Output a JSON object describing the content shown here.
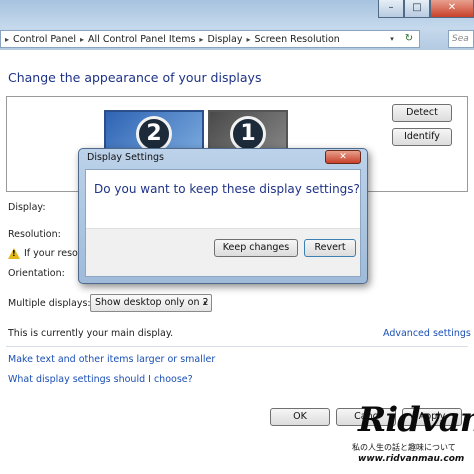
{
  "window": {
    "minimize_glyph": "–",
    "maximize_glyph": "□",
    "close_glyph": "✕"
  },
  "address_bar": {
    "breadcrumbs": [
      "Control Panel",
      "All Control Panel Items",
      "Display",
      "Screen Resolution"
    ],
    "separator": "▸",
    "leading_separator": "▸",
    "dropdown_glyph": "▾",
    "refresh_glyph": "↻",
    "search_placeholder": "Sea"
  },
  "page": {
    "heading": "Change the appearance of your displays",
    "monitors": [
      {
        "number": "2",
        "selected": true
      },
      {
        "number": "1",
        "selected": false
      }
    ],
    "detect_label": "Detect",
    "identify_label": "Identify",
    "display_label": "Display:",
    "resolution_label": "Resolution:",
    "warning_text": "If your resolu",
    "orientation_label": "Orientation:",
    "multiple_displays_label": "Multiple displays:",
    "multiple_displays_value": "Show desktop only on 2",
    "main_display_text": "This is currently your main display.",
    "advanced_settings_link": "Advanced settings",
    "link_text_size": "Make text and other items larger or smaller",
    "link_what_settings": "What display settings should I choose?",
    "ok_label": "OK",
    "cancel_label": "Canc",
    "apply_label": "Apply"
  },
  "dialog": {
    "title": "Display Settings",
    "close_glyph": "✕",
    "question": "Do you want to keep these display settings?",
    "keep_label": "Keep changes",
    "revert_label": "Revert"
  },
  "watermark": {
    "logo": "Ridvan",
    "subtitle": "私の人生の話と趣味について",
    "url": "www.ridvanmau.com"
  },
  "colors": {
    "heading_blue": "#1e3287",
    "link_blue": "#1a4fb5",
    "titlebar": "#b3cae2",
    "close_red": "#c8402a"
  }
}
